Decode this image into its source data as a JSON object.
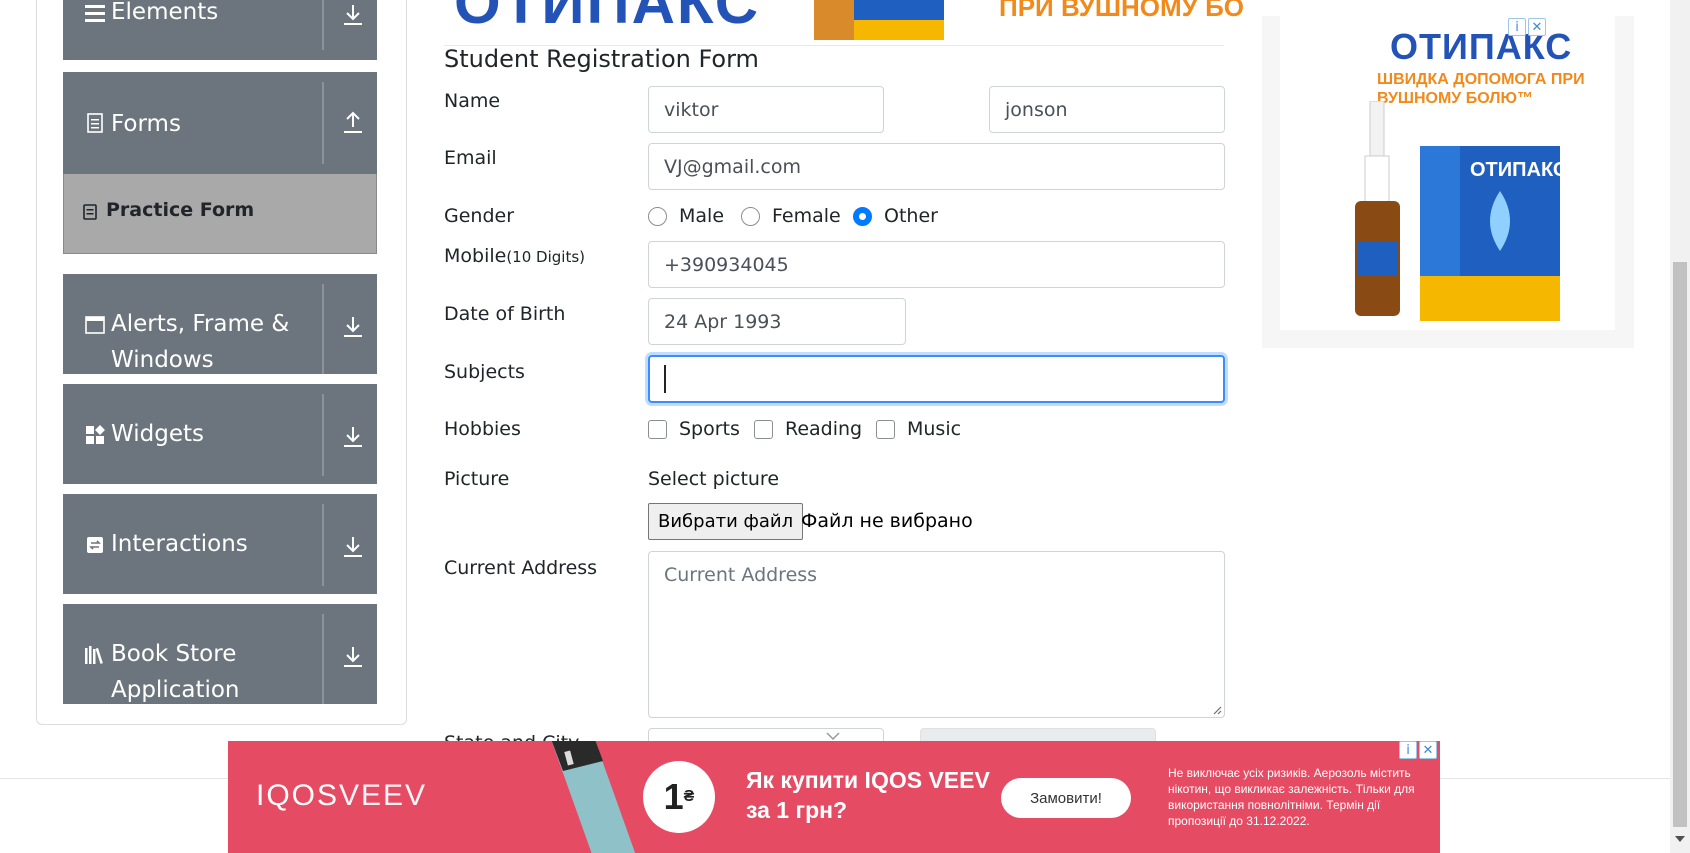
{
  "sidebar": {
    "groups": [
      {
        "label": "Elements",
        "icon": "hamburger-icon",
        "arrow": "down"
      },
      {
        "label": "Forms",
        "icon": "document-icon",
        "arrow": "up"
      },
      {
        "label": "Alerts, Frame &",
        "label2": "Windows",
        "icon": "window-icon",
        "arrow": "down"
      },
      {
        "label": "Widgets",
        "icon": "widgets-icon",
        "arrow": "down"
      },
      {
        "label": "Interactions",
        "icon": "interactions-icon",
        "arrow": "down"
      },
      {
        "label": "Book Store",
        "label2": "Application",
        "icon": "books-icon",
        "arrow": "down"
      }
    ],
    "active_item": {
      "label": "Practice Form",
      "icon": "form-icon"
    }
  },
  "top_ad": {
    "brand": "ОТИПАКС",
    "tagline": "ПРИ ВУШНОМУ БО"
  },
  "form": {
    "title": "Student Registration Form",
    "name_label": "Name",
    "first_name": "viktor",
    "last_name": "jonson",
    "email_label": "Email",
    "email": "VJ@gmail.com",
    "gender_label": "Gender",
    "gender_options": [
      "Male",
      "Female",
      "Other"
    ],
    "gender_selected": "Other",
    "mobile_label": "Mobile",
    "mobile_hint": "(10 Digits)",
    "mobile": "+390934045",
    "dob_label": "Date of Birth",
    "dob": "24 Apr 1993",
    "subjects_label": "Subjects",
    "subjects_value": "",
    "hobbies_label": "Hobbies",
    "hobbies": [
      "Sports",
      "Reading",
      "Music"
    ],
    "picture_label": "Picture",
    "picture_hint": "Select picture",
    "file_button": "Вибрати файл",
    "file_status": "Файл не вибрано",
    "address_label": "Current Address",
    "address_placeholder": "Current Address",
    "state_city_label": "State and City"
  },
  "side_ad": {
    "brand": "ОТИПАКС",
    "tagline": "ШВИДКА ДОПОМОГА ПРИ ВУШНОМУ БОЛЮ™",
    "product_label": "ОТИПАКС"
  },
  "bottom_ad": {
    "logo_a": "IQOS",
    "logo_b": "VEEV",
    "price": "1",
    "currency": "₴",
    "headline": "Як купити IQOS VEEV за 1 грн?",
    "cta": "Замовити!",
    "disclaimer": "Не виключає усіх ризиків. Аерозоль містить нікотин, що викликає залежність. Тільки для використання повнолітніми. Термін дії пропозиції до 31.12.2022."
  },
  "colors": {
    "sidebar_bg": "#6c757d",
    "active_bg": "#a9a9a9",
    "ad_red": "#e54b63",
    "brand_blue": "#2453b8",
    "brand_orange": "#f18a1b",
    "radio_blue": "#007bff"
  }
}
